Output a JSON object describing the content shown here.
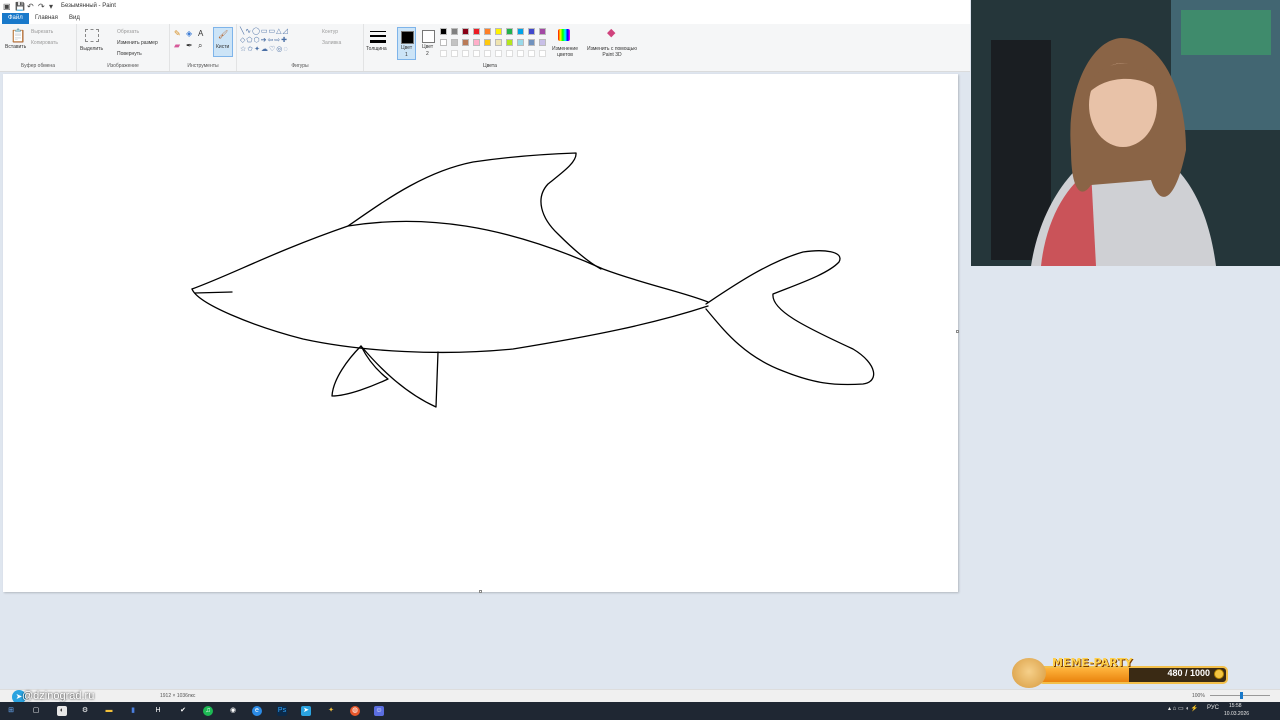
{
  "window": {
    "title": "Безымянный - Paint"
  },
  "tabs": [
    {
      "label": "Файл"
    },
    {
      "label": "Главная"
    },
    {
      "label": "Вид"
    }
  ],
  "ribbon": {
    "clipboard": {
      "paste": "Вставить",
      "cut": "Вырезать",
      "copy": "Копировать",
      "group": "Буфер обмена"
    },
    "image": {
      "select": "Выделить",
      "crop": "Обрезать",
      "resize": "Изменить размер",
      "rotate": "Повернуть",
      "group": "Изображение"
    },
    "tools": {
      "group": "Инструменты",
      "brushes": "Кисти"
    },
    "shapes": {
      "outline": "Контур",
      "fill": "Заливка",
      "group": "Фигуры"
    },
    "size": {
      "label": "Толщина"
    },
    "color1": {
      "label": "Цвет",
      "sub": "1"
    },
    "color2": {
      "label": "Цвет",
      "sub": "2"
    },
    "colors": {
      "group": "Цвета",
      "edit": "Изменение цветов",
      "paint3d": "Изменить с помощью Paint 3D",
      "palette_row1": [
        "#000000",
        "#7f7f7f",
        "#880015",
        "#ed1c24",
        "#ff7f27",
        "#fff200",
        "#22b14c",
        "#00a2e8",
        "#3f48cc",
        "#a349a4"
      ],
      "palette_row2": [
        "#ffffff",
        "#c3c3c3",
        "#b97a57",
        "#ffaec9",
        "#ffc90e",
        "#efe4b0",
        "#b5e61d",
        "#99d9ea",
        "#7092be",
        "#c8bfe7"
      ]
    }
  },
  "status": {
    "dimensions": "1912 × 1036пкс",
    "zoom": "100%"
  },
  "taskbar": {
    "time": "15:58",
    "date": "10.03.2026",
    "lang": "РУС"
  },
  "overlay": {
    "watermark": "@dzinograd.ru",
    "meme_title": "MEME-PARTY",
    "meme_count": "480 / 1000",
    "meme_progress": 0.48
  }
}
